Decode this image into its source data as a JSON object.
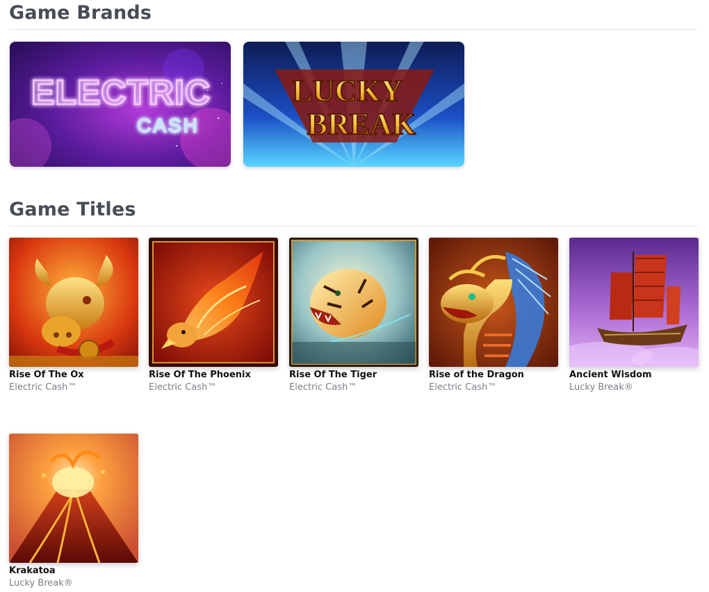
{
  "sections": {
    "brands_heading": "Game Brands",
    "titles_heading": "Game Titles"
  },
  "brands": [
    {
      "name": "Electric Cash",
      "logo_line1": "ELECTRIC",
      "logo_line2": "CASH"
    },
    {
      "name": "Lucky Break",
      "logo_line1": "LUCKY",
      "logo_line2": "BREAK"
    }
  ],
  "games": [
    {
      "title": "Rise Of The Ox",
      "brand": "Electric Cash™",
      "art": "golden-ox-icon"
    },
    {
      "title": "Rise Of The Phoenix",
      "brand": "Electric Cash™",
      "art": "phoenix-icon"
    },
    {
      "title": "Rise Of The Tiger",
      "brand": "Electric Cash™",
      "art": "tiger-icon"
    },
    {
      "title": "Rise of the Dragon",
      "brand": "Electric Cash™",
      "art": "dragon-icon"
    },
    {
      "title": "Ancient Wisdom",
      "brand": "Lucky Break®",
      "art": "junk-ship-icon"
    },
    {
      "title": "Krakatoa",
      "brand": "Lucky Break®",
      "art": "volcano-icon"
    }
  ],
  "colors": {
    "heading": "#474c55",
    "divider": "#dfe1e4",
    "subtitle": "#7a7f87",
    "electric_neon": "#e9b3ff",
    "lucky_gold": "#f6c343"
  }
}
